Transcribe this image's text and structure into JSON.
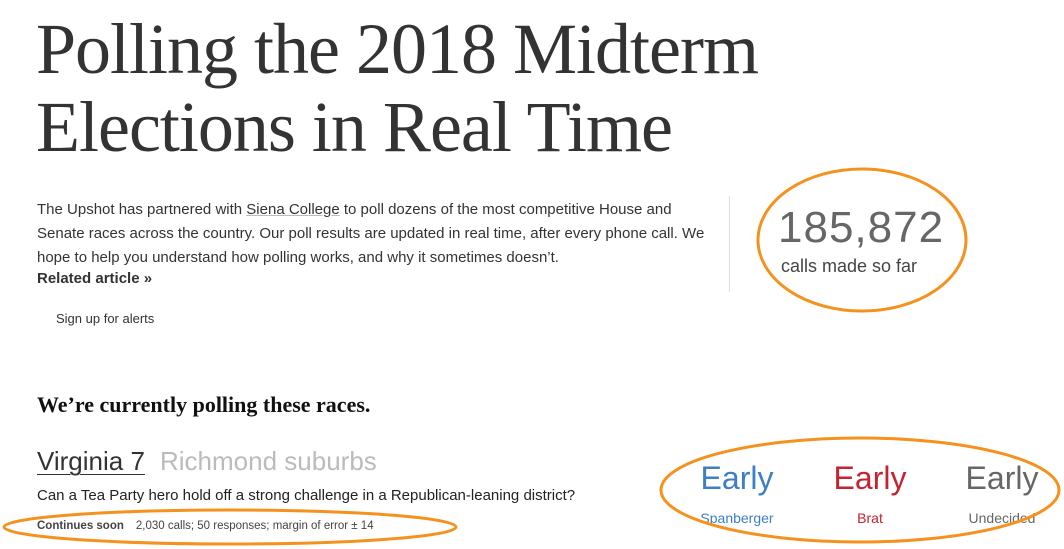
{
  "header": {
    "title": "Polling the 2018 Midterm Elections in Real Time"
  },
  "intro": {
    "text_before": "The Upshot has partnered with ",
    "link_text": "Siena College",
    "text_after": " to poll dozens of the most competitive House and Senate races across the country. Our poll results are updated in real time, after every phone call. We hope to help you understand how polling works, and why it sometimes doesn’t.",
    "related_link": "Related article »"
  },
  "stats": {
    "calls_count": "185,872",
    "calls_label": "calls made so far"
  },
  "signup": {
    "label": "Sign up for alerts"
  },
  "section": {
    "title": "We’re currently polling these races."
  },
  "race": {
    "name": "Virginia 7",
    "region": "Richmond suburbs",
    "question": "Can a Tea Party hero hold off a strong challenge in a Republican-leaning district?",
    "status": "Continues soon",
    "details": "2,030 calls; 50 responses; margin of error ± 14",
    "candidates": [
      {
        "estimate": "Early",
        "name": "Spanberger",
        "color": "#3d7fc4"
      },
      {
        "estimate": "Early",
        "name": "Brat",
        "color": "#c4232f"
      },
      {
        "estimate": "Early",
        "name": "Undecided",
        "color": "#666666"
      }
    ]
  },
  "annotation": {
    "color": "#f5921e"
  }
}
